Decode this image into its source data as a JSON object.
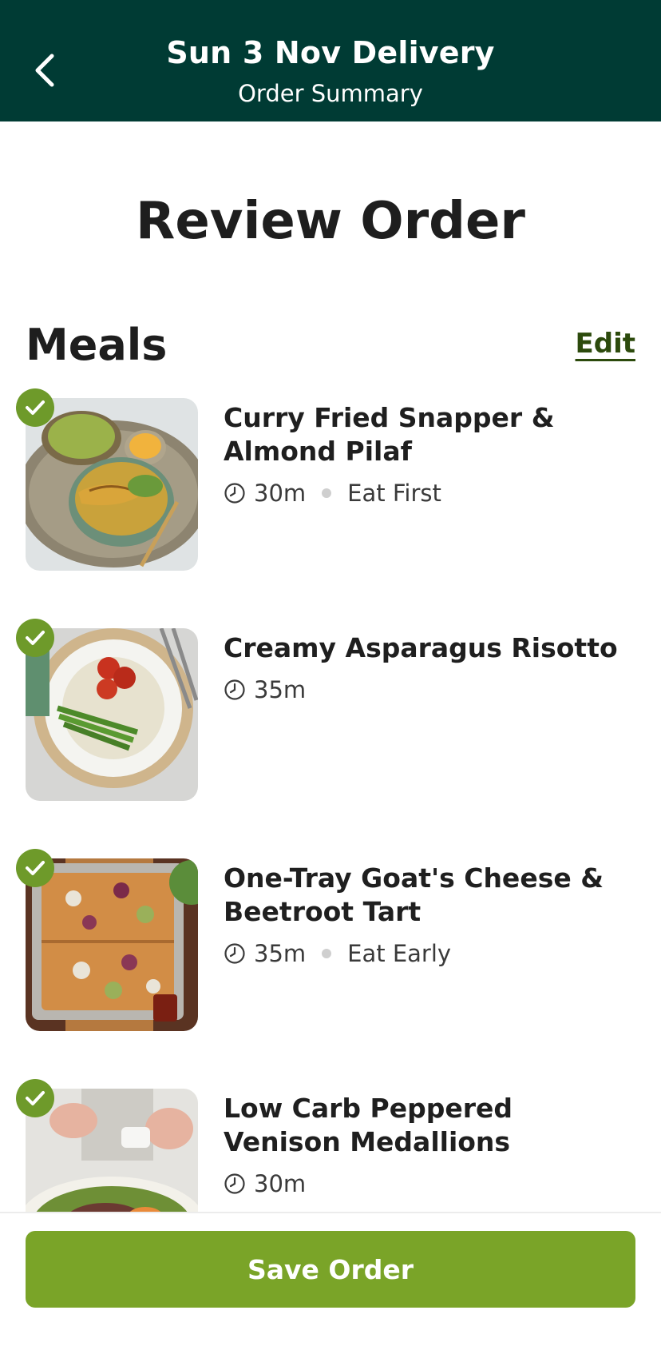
{
  "header": {
    "title": "Sun 3 Nov Delivery",
    "subtitle": "Order Summary"
  },
  "page_title": "Review Order",
  "meals_section": {
    "title": "Meals",
    "edit_label": "Edit"
  },
  "meals": [
    {
      "name": "Curry Fried Snapper & Almond Pilaf",
      "time": "30m",
      "tag": "Eat First",
      "image": "snapper-pilaf-photo"
    },
    {
      "name": "Creamy Asparagus Risotto",
      "time": "35m",
      "tag": "",
      "image": "asparagus-risotto-photo"
    },
    {
      "name": "One-Tray Goat's Cheese & Beetroot Tart",
      "time": "35m",
      "tag": "Eat Early",
      "image": "beetroot-tart-photo"
    },
    {
      "name": "Low Carb Peppered Venison Medallions",
      "time": "30m",
      "tag": "",
      "image": "venison-medallions-photo"
    }
  ],
  "save_button": {
    "label": "Save Order"
  },
  "colors": {
    "header_bg": "#003b34",
    "accent_green": "#7aa428",
    "check_green": "#6e9a2a",
    "edit_link": "#2c4a0c"
  },
  "icons": {
    "back": "chevron-left-icon",
    "check": "check-icon",
    "clock": "clock-icon"
  }
}
